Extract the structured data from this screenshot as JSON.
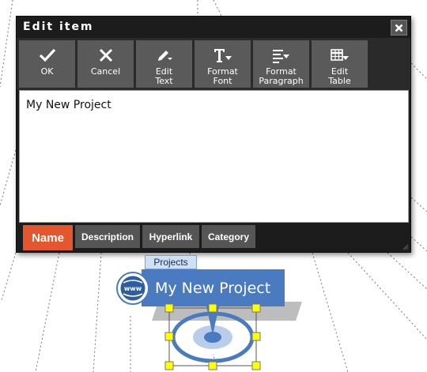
{
  "dialog": {
    "title": "Edit item",
    "close_icon": "close-icon",
    "toolbar": [
      {
        "id": "ok",
        "label": "OK",
        "icon": "check-icon"
      },
      {
        "id": "cancel",
        "label": "Cancel",
        "icon": "x-icon"
      },
      {
        "id": "edit-text",
        "label": "Edit\nText",
        "icon": "pencil-dropdown-icon"
      },
      {
        "id": "format-font",
        "label": "Format\nFont",
        "icon": "font-dropdown-icon"
      },
      {
        "id": "format-paragraph",
        "label": "Format\nParagraph",
        "icon": "paragraph-dropdown-icon"
      },
      {
        "id": "edit-table",
        "label": "Edit\nTable",
        "icon": "table-dropdown-icon"
      }
    ],
    "editor_text": "My New Project",
    "tabs": [
      {
        "id": "name",
        "label": "Name",
        "active": true
      },
      {
        "id": "description",
        "label": "Description",
        "active": false
      },
      {
        "id": "hyperlink",
        "label": "Hyperlink",
        "active": false
      },
      {
        "id": "category",
        "label": "Category",
        "active": false
      }
    ]
  },
  "node": {
    "category_tag": "Projects",
    "label": "My New Project",
    "icon": "www-globe-icon"
  },
  "colors": {
    "dialog_bg": "#1c1c1c",
    "button_bg": "#5a5a5a",
    "active_tab": "#e4572e",
    "node_blue": "#4a7ac0",
    "handle_yellow": "#ffff00"
  }
}
